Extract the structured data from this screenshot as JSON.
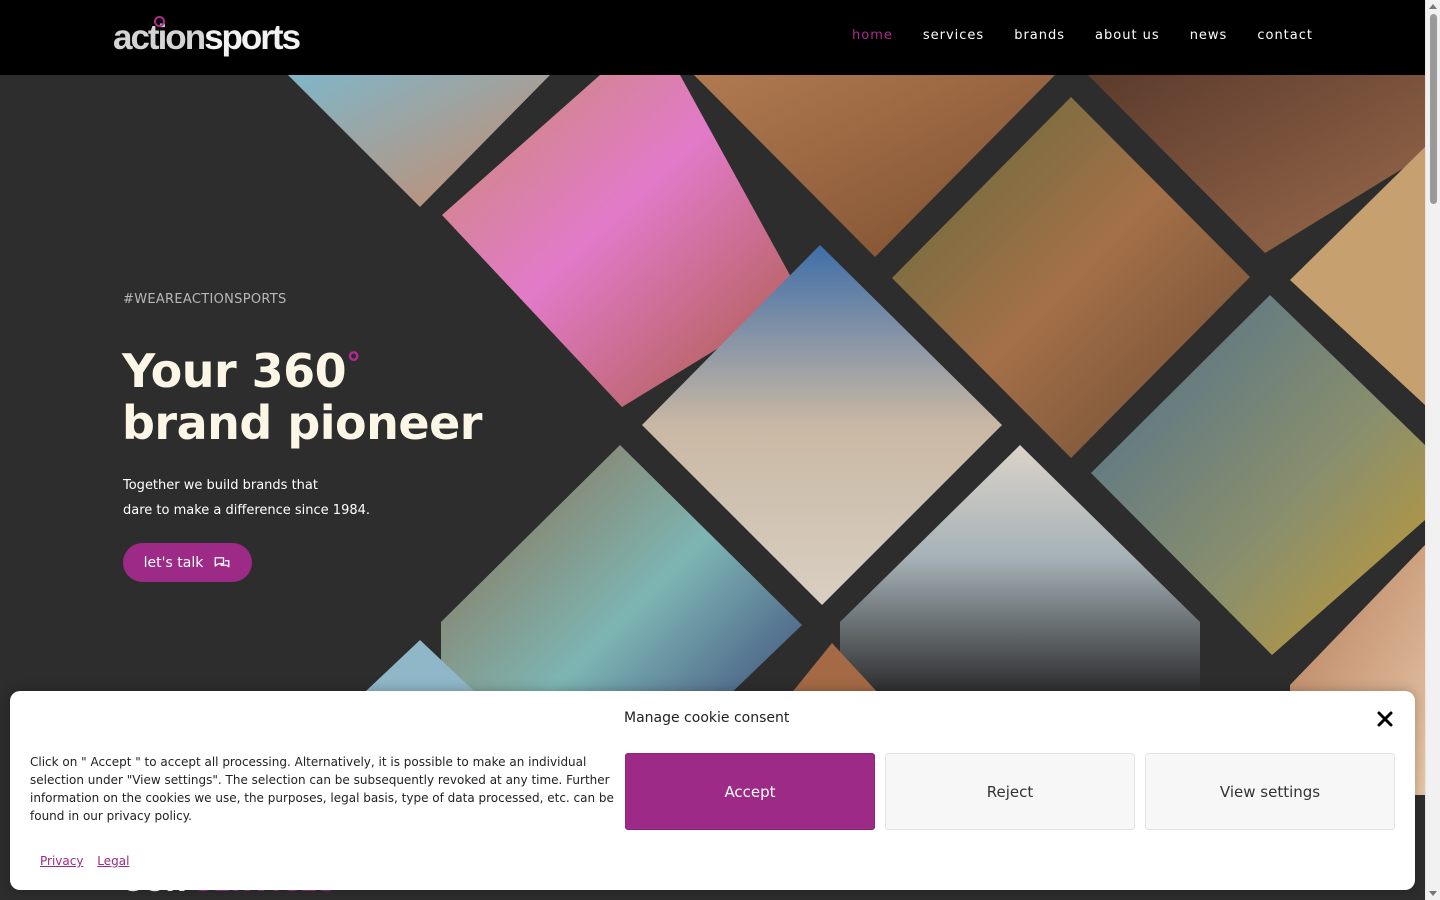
{
  "brand": {
    "logo_part1": "action",
    "logo_part2": "sports",
    "accent": "#9c2a86"
  },
  "nav": {
    "items": [
      {
        "label": "home",
        "active": true
      },
      {
        "label": "services"
      },
      {
        "label": "brands"
      },
      {
        "label": "about us"
      },
      {
        "label": "news"
      },
      {
        "label": "contact"
      }
    ]
  },
  "hero": {
    "tagline": "#WEAREACTIONSPORTS",
    "headline_line1": "Your 360",
    "headline_degree": "°",
    "headline_line2": "brand pioneer",
    "sub_line1": "Together we build brands that",
    "sub_line2": "dare to make a difference since 1984.",
    "cta_label": "let's talk",
    "cta_icon": "chat-bubbles-icon"
  },
  "services_peek": {
    "word1": "OUR",
    "word2": "SERVICES"
  },
  "cookie": {
    "title": "Manage cookie consent",
    "text": "Click on \" Accept \" to accept all processing. Alternatively, it is possible to make an individual selection under \"View settings\". The selection can be subsequently revoked at any time. Further information on the cookies we use, the purposes, legal basis, type of data processed, etc. can be found in our privacy policy.",
    "accept_label": "Accept",
    "reject_label": "Reject",
    "view_settings_label": "View settings",
    "privacy_link": "Privacy",
    "legal_link": "Legal"
  }
}
